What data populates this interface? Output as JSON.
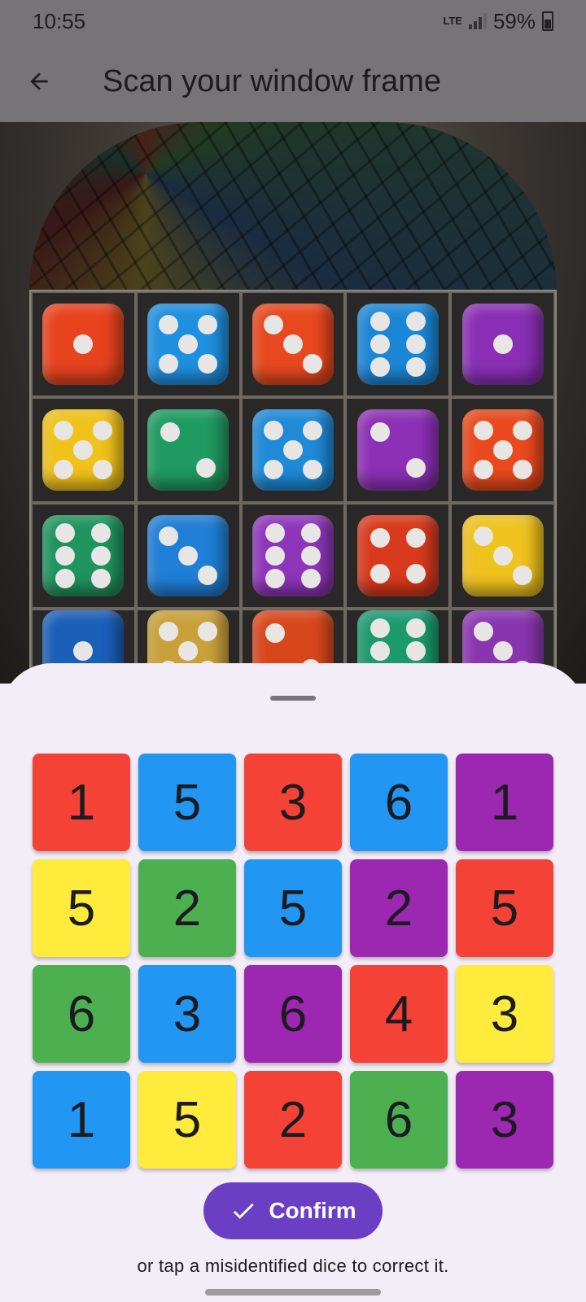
{
  "status_bar": {
    "time": "10:55",
    "network": "LTE",
    "battery": "59%"
  },
  "app_bar": {
    "title": "Scan your window frame",
    "back_icon": "arrow-left-icon"
  },
  "camera_dice": [
    [
      "#e8431f",
      "#1f8fe0",
      "#e8481e",
      "#1c86d6",
      "#8a2fb5"
    ],
    [
      "#f0c21a",
      "#1f9a62",
      "#1e8ad8",
      "#8c30b6",
      "#e9491d"
    ],
    [
      "#1f9460",
      "#1f7fd6",
      "#8e35ba",
      "#d9391c",
      "#efc21e"
    ],
    [
      "#1a5fb8",
      "#c9a13a",
      "#d8471c",
      "#1c9a6e",
      "#8a35b0"
    ]
  ],
  "dice_grid": [
    [
      {
        "value": "1",
        "color": "#F44336"
      },
      {
        "value": "5",
        "color": "#2196F3"
      },
      {
        "value": "3",
        "color": "#F44336"
      },
      {
        "value": "6",
        "color": "#2196F3"
      },
      {
        "value": "1",
        "color": "#9C27B0"
      }
    ],
    [
      {
        "value": "5",
        "color": "#FFEB3B"
      },
      {
        "value": "2",
        "color": "#4CAF50"
      },
      {
        "value": "5",
        "color": "#2196F3"
      },
      {
        "value": "2",
        "color": "#9C27B0"
      },
      {
        "value": "5",
        "color": "#F44336"
      }
    ],
    [
      {
        "value": "6",
        "color": "#4CAF50"
      },
      {
        "value": "3",
        "color": "#2196F3"
      },
      {
        "value": "6",
        "color": "#9C27B0"
      },
      {
        "value": "4",
        "color": "#F44336"
      },
      {
        "value": "3",
        "color": "#FFEB3B"
      }
    ],
    [
      {
        "value": "1",
        "color": "#2196F3"
      },
      {
        "value": "5",
        "color": "#FFEB3B"
      },
      {
        "value": "2",
        "color": "#F44336"
      },
      {
        "value": "6",
        "color": "#4CAF50"
      },
      {
        "value": "3",
        "color": "#9C27B0"
      }
    ]
  ],
  "confirm": {
    "label": "Confirm",
    "icon": "check-icon",
    "color": "#6b3fc4"
  },
  "hint": "or tap a misidentified dice to correct it."
}
